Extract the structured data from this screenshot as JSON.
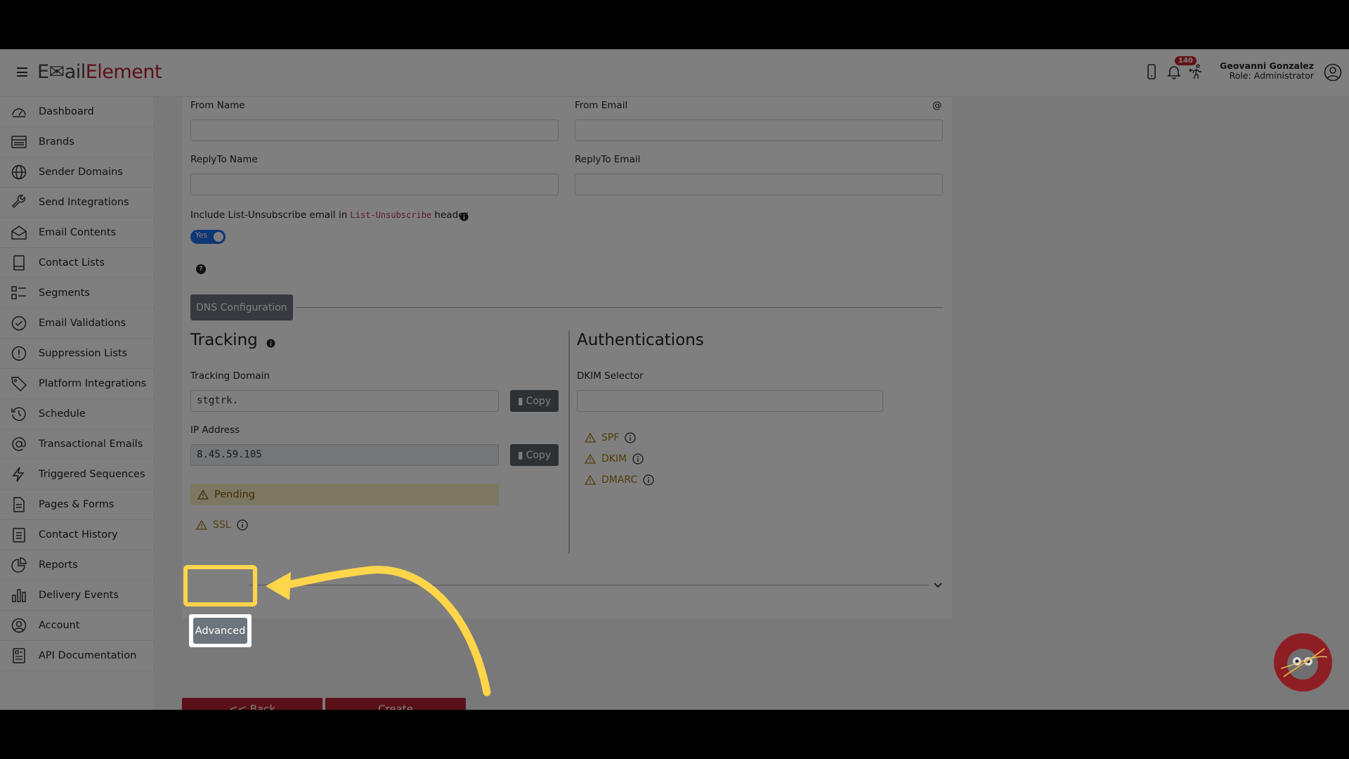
{
  "app": {
    "logo_part1": "E",
    "logo_part2": "ail",
    "logo_part3": "Element"
  },
  "header": {
    "notification_count": "140",
    "user_name": "Geovanni Gonzalez",
    "user_role": "Role: Administrator"
  },
  "sidebar": {
    "items": [
      {
        "label": "Dashboard",
        "icon": "dashboard-icon"
      },
      {
        "label": "Brands",
        "icon": "brands-icon"
      },
      {
        "label": "Sender Domains",
        "icon": "globe-icon"
      },
      {
        "label": "Send Integrations",
        "icon": "wrench-icon"
      },
      {
        "label": "Email Contents",
        "icon": "envelope-icon"
      },
      {
        "label": "Contact Lists",
        "icon": "book-icon"
      },
      {
        "label": "Segments",
        "icon": "segments-icon"
      },
      {
        "label": "Email Validations",
        "icon": "check-circle-icon"
      },
      {
        "label": "Suppression Lists",
        "icon": "exclamation-circle-icon"
      },
      {
        "label": "Platform Integrations",
        "icon": "tag-icon"
      },
      {
        "label": "Schedule",
        "icon": "clock-icon"
      },
      {
        "label": "Transactional Emails",
        "icon": "at-icon"
      },
      {
        "label": "Triggered Sequences",
        "icon": "lightning-icon"
      },
      {
        "label": "Pages & Forms",
        "icon": "document-icon"
      },
      {
        "label": "Contact History",
        "icon": "clipboard-icon"
      },
      {
        "label": "Reports",
        "icon": "pie-chart-icon"
      },
      {
        "label": "Delivery Events",
        "icon": "bar-chart-icon"
      },
      {
        "label": "Account",
        "icon": "person-circle-icon"
      },
      {
        "label": "API Documentation",
        "icon": "api-doc-icon"
      }
    ]
  },
  "form": {
    "from_name_label": "From Name",
    "from_email_label": "From Email",
    "from_email_suffix": "@",
    "replyto_name_label": "ReplyTo Name",
    "replyto_email_label": "ReplyTo Email",
    "unsub_label_before": "Include List-Unsubscribe email in ",
    "unsub_code": "List-Unsubscribe",
    "unsub_label_after": " header",
    "unsub_toggle": "Yes",
    "help_glyph": "?",
    "dns_button": "DNS Configuration",
    "tracking_title": "Tracking",
    "tracking_domain_label": "Tracking Domain",
    "tracking_domain_value": "stgtrk.",
    "copy_label": "Copy",
    "ip_label": "IP Address",
    "ip_value": "8.45.59.105",
    "pending_label": "Pending",
    "ssl_label": "SSL",
    "auth_title": "Authentications",
    "dkim_selector_label": "DKIM Selector",
    "dkim_selector_value": "",
    "spf_label": "SPF",
    "dkim_label": "DKIM",
    "dmarc_label": "DMARC",
    "advanced_button": "Advanced",
    "back_button": "<< Back",
    "create_button": "Create"
  },
  "colors": {
    "brand_red": "#b5202e",
    "highlight": "#ffd54a",
    "toggle_blue": "#1f6feb"
  }
}
